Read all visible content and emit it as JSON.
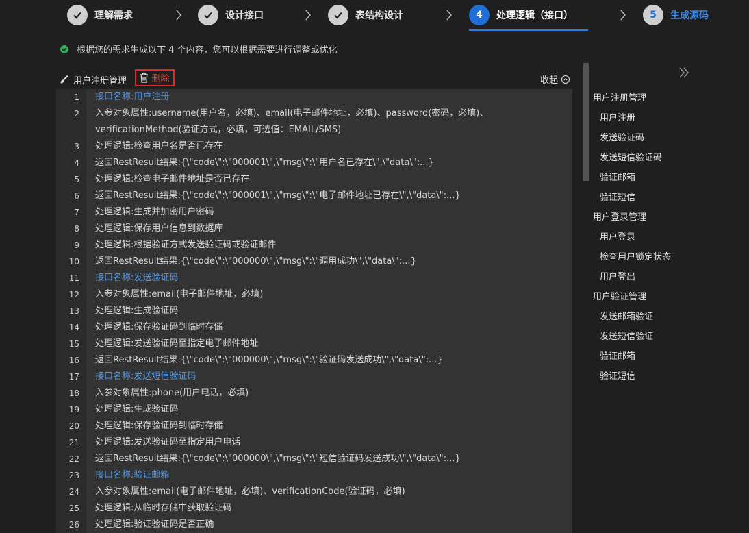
{
  "steps": [
    {
      "num": "",
      "label": "理解需求",
      "state": "done"
    },
    {
      "num": "",
      "label": "设计接口",
      "state": "done"
    },
    {
      "num": "",
      "label": "表结构设计",
      "state": "done"
    },
    {
      "num": "4",
      "label": "处理逻辑（接口）",
      "state": "active"
    },
    {
      "num": "5",
      "label": "生成源码",
      "state": "todo"
    }
  ],
  "info_text": "根据您的需求生成以下 4 个内容，您可以根据需要进行调整或优化",
  "toolbar": {
    "title": "用户注册管理",
    "delete_label": "删除",
    "collapse_label": "收起"
  },
  "code_lines": [
    {
      "n": "1",
      "text": "接口名称:用户注册",
      "hl": true
    },
    {
      "n": "2",
      "text": "入参对象属性:username(用户名，必填)、email(电子邮件地址，必填)、password(密码，必填)、verificationMethod(验证方式，必填，可选值：EMAIL/SMS)",
      "hl": false
    },
    {
      "n": "3",
      "text": "处理逻辑:检查用户名是否已存在",
      "hl": false
    },
    {
      "n": "4",
      "text": "返回RestResult结果:{\\\"code\\\":\\\"000001\\\",\\\"msg\\\":\\\"用户名已存在\\\",\\\"data\\\":...}",
      "hl": false
    },
    {
      "n": "5",
      "text": "处理逻辑:检查电子邮件地址是否已存在",
      "hl": false
    },
    {
      "n": "6",
      "text": "返回RestResult结果:{\\\"code\\\":\\\"000001\\\",\\\"msg\\\":\\\"电子邮件地址已存在\\\",\\\"data\\\":...}",
      "hl": false
    },
    {
      "n": "7",
      "text": "处理逻辑:生成并加密用户密码",
      "hl": false
    },
    {
      "n": "8",
      "text": "处理逻辑:保存用户信息到数据库",
      "hl": false
    },
    {
      "n": "9",
      "text": "处理逻辑:根据验证方式发送验证码或验证邮件",
      "hl": false
    },
    {
      "n": "10",
      "text": "返回RestResult结果:{\\\"code\\\":\\\"000000\\\",\\\"msg\\\":\\\"调用成功\\\",\\\"data\\\":...}",
      "hl": false
    },
    {
      "n": "11",
      "text": "接口名称:发送验证码",
      "hl": true
    },
    {
      "n": "12",
      "text": "入参对象属性:email(电子邮件地址，必填)",
      "hl": false
    },
    {
      "n": "13",
      "text": "处理逻辑:生成验证码",
      "hl": false
    },
    {
      "n": "14",
      "text": "处理逻辑:保存验证码到临时存储",
      "hl": false
    },
    {
      "n": "15",
      "text": "处理逻辑:发送验证码至指定电子邮件地址",
      "hl": false
    },
    {
      "n": "16",
      "text": "返回RestResult结果:{\\\"code\\\":\\\"000000\\\",\\\"msg\\\":\\\"验证码发送成功\\\",\\\"data\\\":...}",
      "hl": false
    },
    {
      "n": "17",
      "text": "接口名称:发送短信验证码",
      "hl": true
    },
    {
      "n": "18",
      "text": "入参对象属性:phone(用户电话，必填)",
      "hl": false
    },
    {
      "n": "19",
      "text": "处理逻辑:生成验证码",
      "hl": false
    },
    {
      "n": "20",
      "text": "处理逻辑:保存验证码到临时存储",
      "hl": false
    },
    {
      "n": "21",
      "text": "处理逻辑:发送验证码至指定用户电话",
      "hl": false
    },
    {
      "n": "22",
      "text": "返回RestResult结果:{\\\"code\\\":\\\"000000\\\",\\\"msg\\\":\\\"短信验证码发送成功\\\",\\\"data\\\":...}",
      "hl": false
    },
    {
      "n": "23",
      "text": "接口名称:验证邮箱",
      "hl": true
    },
    {
      "n": "24",
      "text": "入参对象属性:email(电子邮件地址，必填)、verificationCode(验证码，必填)",
      "hl": false
    },
    {
      "n": "25",
      "text": "处理逻辑:从临时存储中获取验证码",
      "hl": false
    },
    {
      "n": "26",
      "text": "处理逻辑:验证验证码是否正确",
      "hl": false
    }
  ],
  "nav": [
    {
      "label": "用户注册管理",
      "level": "group"
    },
    {
      "label": "用户注册",
      "level": "child"
    },
    {
      "label": "发送验证码",
      "level": "child"
    },
    {
      "label": "发送短信验证码",
      "level": "child"
    },
    {
      "label": "验证邮箱",
      "level": "child"
    },
    {
      "label": "验证短信",
      "level": "child"
    },
    {
      "label": "用户登录管理",
      "level": "group"
    },
    {
      "label": "用户登录",
      "level": "child"
    },
    {
      "label": "检查用户锁定状态",
      "level": "child"
    },
    {
      "label": "用户登出",
      "level": "child"
    },
    {
      "label": "用户验证管理",
      "level": "group"
    },
    {
      "label": "发送邮箱验证",
      "level": "child"
    },
    {
      "label": "发送短信验证",
      "level": "child"
    },
    {
      "label": "验证邮箱",
      "level": "child"
    },
    {
      "label": "验证短信",
      "level": "child"
    }
  ],
  "colors": {
    "accent": "#1f6fd6",
    "highlight": "#4f97e8",
    "danger": "#e02a2a",
    "success": "#2fae5e"
  }
}
